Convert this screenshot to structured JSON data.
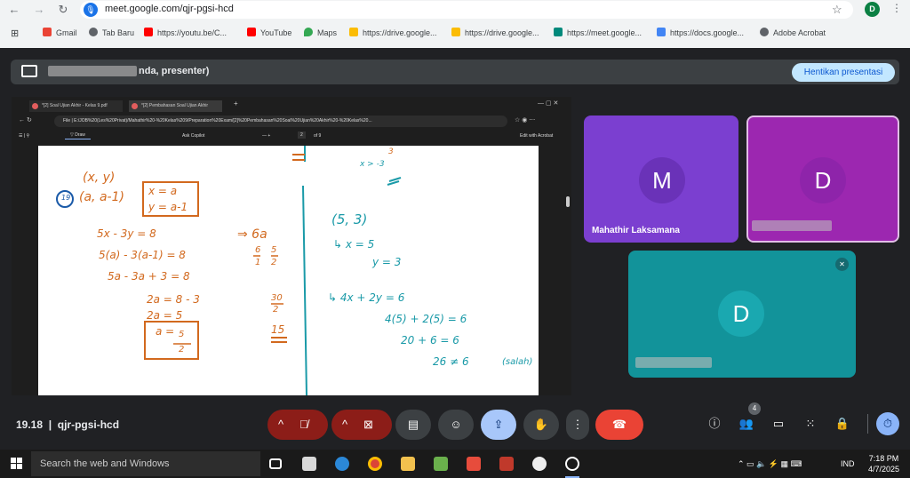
{
  "browser": {
    "url": "meet.google.com/qjr-pgsi-hcd",
    "profile_initial": "D",
    "bookmarks": [
      {
        "label": "Gmail",
        "color": "#ea4335"
      },
      {
        "label": "Tab Baru",
        "color": "#5f6368"
      },
      {
        "label": "https://youtu.be/C...",
        "color": "#ff0000"
      },
      {
        "label": "YouTube",
        "color": "#ff0000"
      },
      {
        "label": "Maps",
        "color": "#34a853"
      },
      {
        "label": "https://drive.google...",
        "color": "#fbbc04"
      },
      {
        "label": "https://drive.google...",
        "color": "#fbbc04"
      },
      {
        "label": "https://meet.google...",
        "color": "#00897b"
      },
      {
        "label": "https://docs.google...",
        "color": "#4285f4"
      },
      {
        "label": "Adobe Acrobat",
        "color": "#5f6368"
      }
    ]
  },
  "presentation": {
    "presenter_label": "nda, presenter)",
    "stop_button": "Hentikan presentasi"
  },
  "shared_screen": {
    "tabs": [
      "*[2] Soal Ujian Akhir - Kelas 9.pdf",
      "*[2] Pembahasan Soal Ujian Akhir"
    ],
    "address_prefix": "File",
    "address": "E:/JOB%20(Les%20Privat)/Mahathir%20-%20Kelas%209/Preparation%20Exam/[2]%20Pembahasan%20Soal%20Ujian%20Akhir%20-%20Kelas%20...",
    "toolbar": {
      "draw": "Draw",
      "ask": "Ask Copilot",
      "page_current": "2",
      "page_total": "of 9",
      "edit": "Edit with Acrobat"
    },
    "handwriting": {
      "top_right": [
        "x > -3",
        "3"
      ],
      "problem_number": "19",
      "point": "(x, y)",
      "point_a": "(a, a-1)",
      "box_x": "x = a",
      "box_y": "y = a-1",
      "eq1": "5x - 3y = 8",
      "eq2": "5(a) - 3(a-1) = 8",
      "eq3": "5a - 3a + 3 = 8",
      "eq4": "2a = 8 - 3",
      "eq5": "2a = 5",
      "ans_a": "a =",
      "ans_num": "5",
      "ans_den": "2",
      "mid1": "⇒ 6a",
      "mid2_frac_l": "6",
      "mid2_den_l": "1",
      "mid2_frac_r": "5",
      "mid2_den_r": "2",
      "mid3_num": "30",
      "mid3_den": "2",
      "mid4": "15",
      "right1": "(5, 3)",
      "right2": "↳ x = 5",
      "right3": "y = 3",
      "right4": "↳ 4x + 2y = 6",
      "right5": "4(5) + 2(5) = 6",
      "right6": "20 + 6 = 6",
      "right7": "26 ≠ 6",
      "right8": "(salah)"
    }
  },
  "participants": [
    {
      "initial": "M",
      "name": "Mahathir Laksamana",
      "color": "#7b3fd0",
      "avatar_color": "#6a32b8"
    },
    {
      "initial": "D",
      "name": "",
      "color": "#9c27b0",
      "avatar_color": "#8e24aa"
    },
    {
      "initial": "D",
      "name": "",
      "color": "#12939a",
      "avatar_color": "#1aa8b0",
      "muted": true
    }
  ],
  "meeting": {
    "time": "19.18",
    "code": "qjr-pgsi-hcd",
    "people_count": "4"
  },
  "taskbar": {
    "search_placeholder": "Search the web and Windows",
    "language": "IND",
    "time": "7:18 PM",
    "date": "4/7/2025"
  }
}
